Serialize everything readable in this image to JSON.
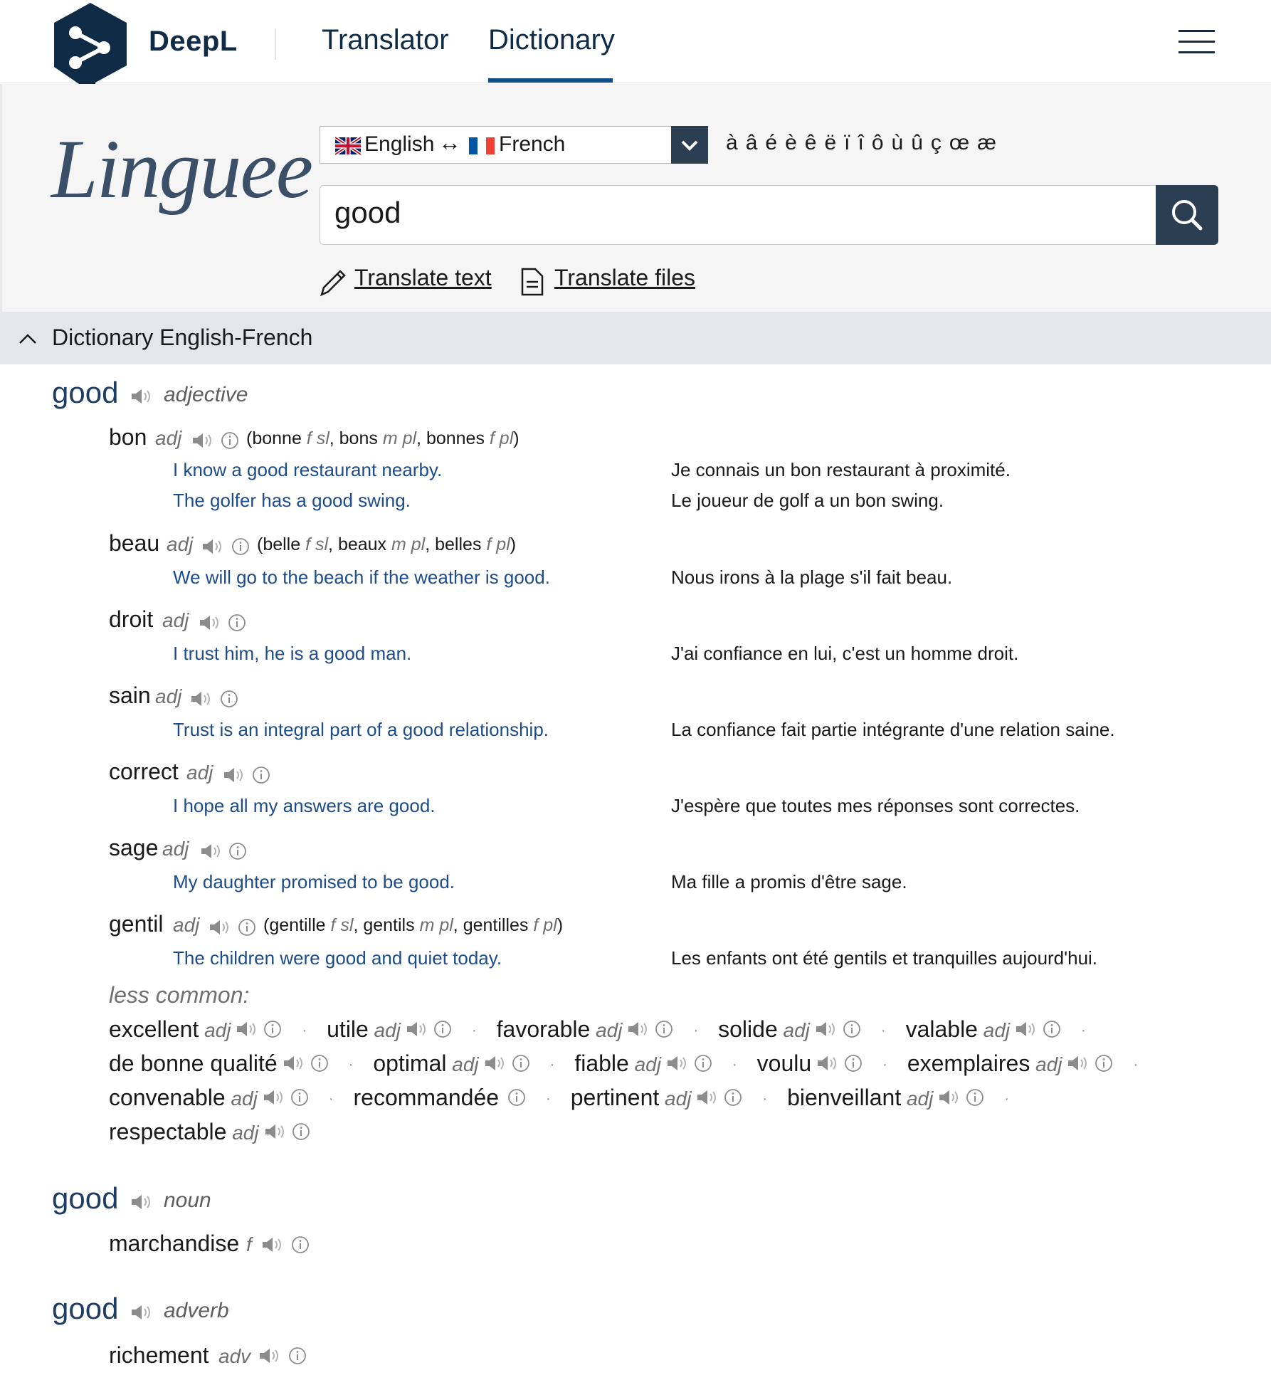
{
  "header": {
    "brand": "DeepL",
    "nav": {
      "translator": "Translator",
      "dictionary": "Dictionary"
    }
  },
  "search": {
    "logo_text": "Linguee",
    "lang_source": "English",
    "lang_arrow": "↔",
    "lang_target": "French",
    "accents": [
      "à",
      "â",
      "é",
      "è",
      "ê",
      "ë",
      "ï",
      "î",
      "ô",
      "ù",
      "û",
      "ç",
      "œ",
      "æ"
    ],
    "query": "good",
    "translate_text": "Translate text",
    "translate_files": "Translate files"
  },
  "dictionary": {
    "title": "Dictionary English-French",
    "entries": [
      {
        "headword": "good",
        "pos": "adjective",
        "translations": [
          {
            "word": "bon",
            "gram": "adj",
            "forms": "(bonne f sl, bons m pl, bonnes f pl)",
            "examples": [
              {
                "en": "I know a good restaurant nearby.",
                "fr": "Je connais un bon restaurant à proximité."
              },
              {
                "en": "The golfer has a good swing.",
                "fr": "Le joueur de golf a un bon swing."
              }
            ]
          },
          {
            "word": "beau",
            "gram": "adj",
            "forms": "(belle f sl, beaux m pl, belles f pl)",
            "examples": [
              {
                "en": "We will go to the beach if the weather is good.",
                "fr": "Nous irons à la plage s'il fait beau."
              }
            ]
          },
          {
            "word": "droit",
            "gram": "adj",
            "examples": [
              {
                "en": "I trust him, he is a good man.",
                "fr": "J'ai confiance en lui, c'est un homme droit."
              }
            ]
          },
          {
            "word": "sain",
            "gram": "adj",
            "examples": [
              {
                "en": "Trust is an integral part of a good relationship.",
                "fr": "La confiance fait partie intégrante d'une relation saine."
              }
            ]
          },
          {
            "word": "correct",
            "gram": "adj",
            "examples": [
              {
                "en": "I hope all my answers are good.",
                "fr": "J'espère que toutes mes réponses sont correctes."
              }
            ]
          },
          {
            "word": "sage",
            "gram": "adj",
            "examples": [
              {
                "en": "My daughter promised to be good.",
                "fr": "Ma fille a promis d'être sage."
              }
            ]
          },
          {
            "word": "gentil",
            "gram": "adj",
            "forms": "(gentille f sl, gentils m pl, gentilles f pl)",
            "examples": [
              {
                "en": "The children were good and quiet today.",
                "fr": "Les enfants ont été gentils et tranquilles aujourd'hui."
              }
            ]
          }
        ],
        "less_common_label": "less common:",
        "less_common": [
          [
            "excellent adj",
            "utile adj",
            "favorable adj",
            "solide adj",
            "valable adj"
          ],
          [
            "de bonne qualité",
            "optimal adj",
            "fiable adj",
            "voulu",
            "exemplaires adj"
          ],
          [
            "convenable adj",
            "recommandée",
            "pertinent adj",
            "bienveillant adj"
          ],
          [
            "respectable adj"
          ]
        ]
      },
      {
        "headword": "good",
        "pos": "noun",
        "translations": [
          {
            "word": "marchandise",
            "gram": "f"
          }
        ]
      },
      {
        "headword": "good",
        "pos": "adverb",
        "translations": [
          {
            "word": "richement",
            "gram": "adv"
          }
        ]
      }
    ]
  }
}
